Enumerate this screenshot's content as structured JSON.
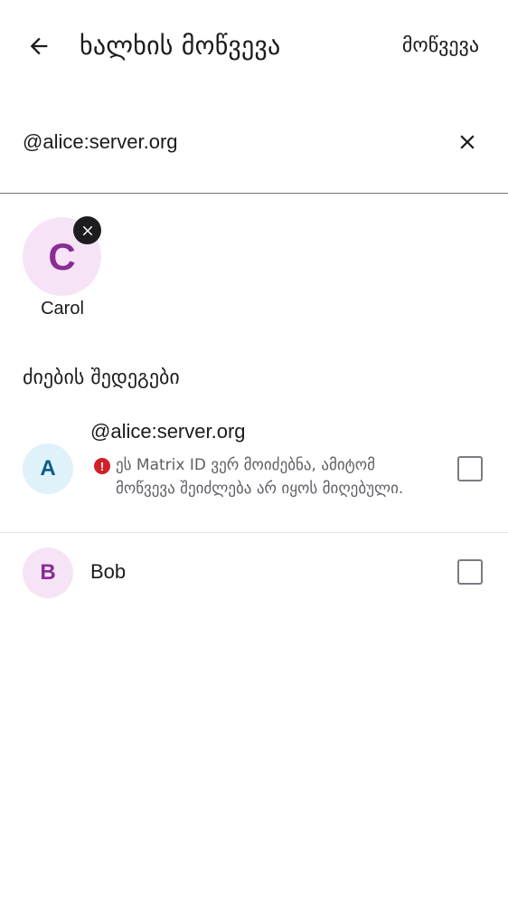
{
  "header": {
    "title": "ხალხის მოწვევა",
    "action_label": "მოწვევა",
    "back_icon": "arrow-back-icon"
  },
  "search": {
    "value": "@alice:server.org",
    "clear_icon": "close-icon"
  },
  "selected": [
    {
      "initial": "C",
      "name": "Carol",
      "remove_icon": "close-icon"
    }
  ],
  "results": {
    "header": "ძიების შედეგები",
    "items": [
      {
        "initial": "A",
        "title": "@alice:server.org",
        "warning_icon": "error-icon",
        "warning": "ეს Matrix ID ვერ მოიძებნა, ამიტომ მოწვევა შეიძლება არ იყოს მიღებული.",
        "checked": false
      },
      {
        "initial": "B",
        "title": "Bob",
        "checked": false
      }
    ]
  },
  "colors": {
    "avatar_purple_bg": "#f6e4f6",
    "avatar_purple_fg": "#8a2c96",
    "avatar_blue_bg": "#dff2f9",
    "avatar_blue_fg": "#0b5c8a",
    "error_red": "#d0202c"
  }
}
